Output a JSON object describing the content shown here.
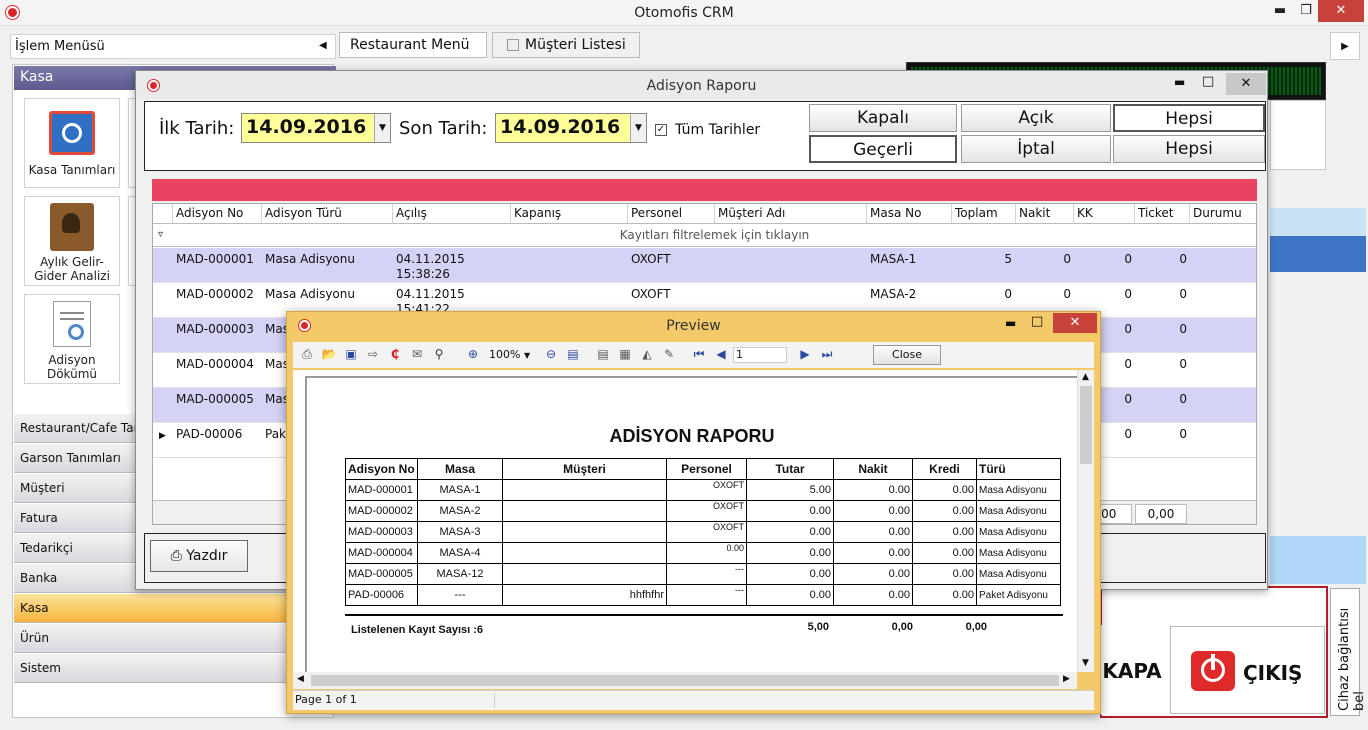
{
  "app": {
    "title": "Otomofis CRM"
  },
  "menu": {
    "label": "İşlem Menüsü"
  },
  "topTabs": [
    {
      "label": "Restaurant Menü"
    },
    {
      "label": "Müşteri Listesi"
    }
  ],
  "leftPanel": {
    "header": "Kasa",
    "tiles": [
      {
        "label": "Kasa Tanımları"
      },
      {
        "label": "Aylık Gelir-Gider Analizi"
      },
      {
        "label": "Adisyon Dökümü"
      }
    ],
    "nav": [
      "Restaurant/Cafe Tan",
      "Garson Tanımları",
      "Müşteri",
      "Fatura",
      "Tedarikçi",
      "Banka",
      "Kasa",
      "Ürün",
      "Sistem"
    ]
  },
  "dialog": {
    "title": "Adisyon Raporu",
    "filters": {
      "start_label": "İlk Tarih:",
      "start_value": "14.09.2016",
      "end_label": "Son Tarih:",
      "end_value": "14.09.2016",
      "all_dates_label": "Tüm Tarihler"
    },
    "status_buttons": [
      "Kapalı",
      "Açık",
      "Hepsi"
    ],
    "validity_buttons": [
      "Geçerli",
      "İptal",
      "Hepsi"
    ],
    "grid": {
      "columns": [
        "Adisyon No",
        "Adisyon Türü",
        "Açılış",
        "Kapanış",
        "Personel",
        "Müşteri Adı",
        "Masa No",
        "Toplam",
        "Nakit",
        "KK",
        "Ticket",
        "Durumu"
      ],
      "filter_hint": "Kayıtları filtrelemek için tıklayın",
      "rows": [
        {
          "no": "MAD-000001",
          "type": "Masa Adisyonu",
          "open": "04.11.2015 15:38:26",
          "personel": "OXOFT",
          "masa": "MASA-1",
          "toplam": "5",
          "nakit": "0",
          "kk": "0",
          "ticket": "0"
        },
        {
          "no": "MAD-000002",
          "type": "Masa Adisyonu",
          "open": "04.11.2015 15:41:22",
          "personel": "OXOFT",
          "masa": "MASA-2",
          "toplam": "0",
          "nakit": "0",
          "kk": "0",
          "ticket": "0"
        },
        {
          "no": "MAD-000003",
          "type": "Mas",
          "open": "",
          "personel": "",
          "masa": "",
          "toplam": "",
          "nakit": "",
          "kk": "0",
          "ticket": "0"
        },
        {
          "no": "MAD-000004",
          "type": "Mas",
          "open": "",
          "personel": "",
          "masa": "",
          "toplam": "",
          "nakit": "",
          "kk": "0",
          "ticket": "0"
        },
        {
          "no": "MAD-000005",
          "type": "Mas",
          "open": "",
          "personel": "",
          "masa": "",
          "toplam": "",
          "nakit": "",
          "kk": "0",
          "ticket": "0"
        },
        {
          "no": "PAD-00006",
          "type": "Pak",
          "open": "",
          "personel": "",
          "masa": "",
          "toplam": "",
          "nakit": "",
          "kk": "0",
          "ticket": "0"
        }
      ],
      "footer": {
        "kk": "0,00",
        "ticket": "0,00"
      }
    },
    "print_button": "Yazdır"
  },
  "preview": {
    "title": "Preview",
    "zoom": "100%",
    "page_input": "1",
    "close_label": "Close",
    "status": "Page 1 of 1",
    "report": {
      "title": "ADİSYON RAPORU",
      "columns": [
        "Adisyon No",
        "Masa",
        "Müşteri",
        "Personel",
        "Tutar",
        "Nakit",
        "Kredi",
        "Türü"
      ],
      "rows": [
        [
          "MAD-000001",
          "MASA-1",
          "",
          "OXOFT",
          "5.00",
          "0.00",
          "0.00",
          "Masa Adisyonu"
        ],
        [
          "MAD-000002",
          "MASA-2",
          "",
          "OXOFT",
          "0.00",
          "0.00",
          "0.00",
          "Masa Adisyonu"
        ],
        [
          "MAD-000003",
          "MASA-3",
          "",
          "OXOFT",
          "0.00",
          "0.00",
          "0.00",
          "Masa Adisyonu"
        ],
        [
          "MAD-000004",
          "MASA-4",
          "",
          "0.00",
          "0.00",
          "0.00",
          "0.00",
          "Masa Adisyonu"
        ],
        [
          "MAD-000005",
          "MASA-12",
          "",
          "---",
          "0.00",
          "0.00",
          "0.00",
          "Masa Adisyonu"
        ],
        [
          "PAD-00006",
          "---",
          "hhfhfhr",
          "---",
          "0.00",
          "0.00",
          "0.00",
          "Paket Adisyonu"
        ]
      ],
      "footer_label": "Listelenen Kayıt Sayısı :6",
      "footer_tutar": "5,00",
      "footer_nakit": "0,00",
      "footer_kredi": "0,00"
    }
  },
  "background": {
    "kapa": "KAPA",
    "cikis": "ÇIKIŞ",
    "vertical_label": "Cihaz bağlantısı bel"
  },
  "colors": {
    "accent_red": "#e8435f",
    "highlight_row": "#d4d3f6",
    "date_bg": "#ffff9a",
    "preview_frame": "#f4c96a"
  }
}
